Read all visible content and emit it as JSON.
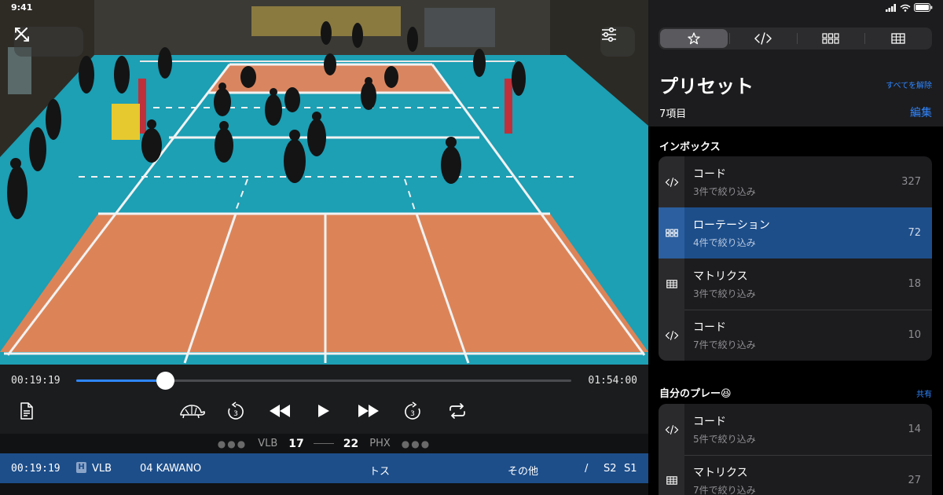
{
  "status": {
    "time": "9:41"
  },
  "video": {
    "close_icon": "close-icon",
    "expand_icon": "expand-icon",
    "settings_icon": "sliders-icon"
  },
  "playback": {
    "current_time": "00:19:19",
    "total_time": "01:54:00",
    "progress": 0.18,
    "controls": [
      "document-icon",
      "turtle-icon",
      "rewind-3-icon",
      "rewind-icon",
      "play-icon",
      "fast-forward-icon",
      "forward-3-icon",
      "repeat-icon"
    ]
  },
  "score": {
    "home": "VLB",
    "home_score": "17",
    "away_score": "22",
    "away": "PHX"
  },
  "event": {
    "time": "00:19:19",
    "badge": "H",
    "team": "VLB",
    "player": "04 KAWANO",
    "skill": "トス",
    "detail": "その他",
    "slash": "/",
    "s2": "S2",
    "s1": "S1"
  },
  "panel": {
    "segments": [
      "star-icon",
      "code-icon",
      "grid-icon",
      "table-icon"
    ],
    "title": "プリセット",
    "deselect_all": "すべてを解除",
    "count": "7項目",
    "edit": "編集",
    "sections": [
      {
        "title": "インボックス",
        "items": [
          {
            "icon": "code-icon",
            "name": "コード",
            "sub": "3件で絞り込み",
            "value": "327"
          },
          {
            "icon": "grid-icon",
            "name": "ローテーション",
            "sub": "4件で絞り込み",
            "value": "72"
          },
          {
            "icon": "table-icon",
            "name": "マトリクス",
            "sub": "3件で絞り込み",
            "value": "18"
          },
          {
            "icon": "code-icon",
            "name": "コード",
            "sub": "7件で絞り込み",
            "value": "10"
          }
        ]
      },
      {
        "title": "自分のプレー😆",
        "share": "共有",
        "items": [
          {
            "icon": "code-icon",
            "name": "コード",
            "sub": "5件で絞り込み",
            "value": "14"
          },
          {
            "icon": "table-icon",
            "name": "マトリクス",
            "sub": "7件で絞り込み",
            "value": "27"
          }
        ]
      }
    ]
  },
  "colors": {
    "accent": "#2f86ff",
    "selected_row": "#1d4e8a",
    "court_blue": "#1aa3b8",
    "court_orange": "#e08a5c"
  }
}
